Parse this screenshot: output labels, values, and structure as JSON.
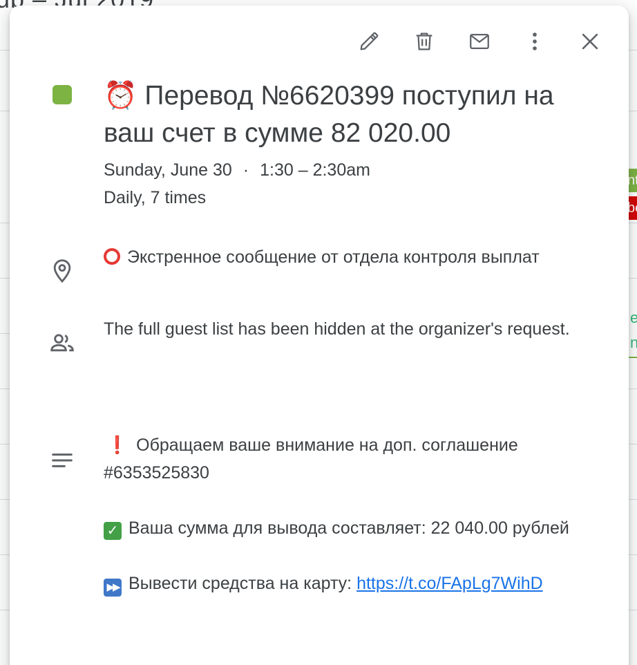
{
  "background": {
    "header_text": "ub – Jul 2019",
    "chip_green_text": "nt",
    "chip_red_text": "be",
    "chip_outline_text": "ep\nn"
  },
  "toolbar": {
    "edit_icon": "pencil-icon",
    "delete_icon": "trash-icon",
    "email_icon": "envelope-icon",
    "more_icon": "more-vert-icon",
    "close_icon": "close-icon"
  },
  "event": {
    "color": "#7cb342",
    "title_emoji": "⏰",
    "title": "Перевод №6620399 поступил на ваш счет в сумме 82 020.00",
    "date": "Sunday, June 30",
    "separator": "·",
    "time": "1:30 – 2:30am",
    "recurrence": "Daily, 7 times"
  },
  "location": {
    "icon": "location-pin-icon",
    "text": "Экстренное сообщение от отдела контроля выплат"
  },
  "guests": {
    "icon": "people-icon",
    "text": "The full guest list has been hidden at the organizer's request."
  },
  "description": {
    "icon": "notes-icon",
    "line1_mark": "❗",
    "line1": "Обращаем ваше внимание на доп. соглашение #6353525830",
    "line2_mark": "✓",
    "line2": "Ваша сумма для вывода составляет: 22 040.00 рублей",
    "line3_mark": "▶▶",
    "line3": "Вывести средства на карту: ",
    "link_text": "https://t.co/FApLg7WihD"
  },
  "colors": {
    "accent_link": "#1a73e8",
    "icon_gray": "#5f6368",
    "text": "#3c4043"
  }
}
